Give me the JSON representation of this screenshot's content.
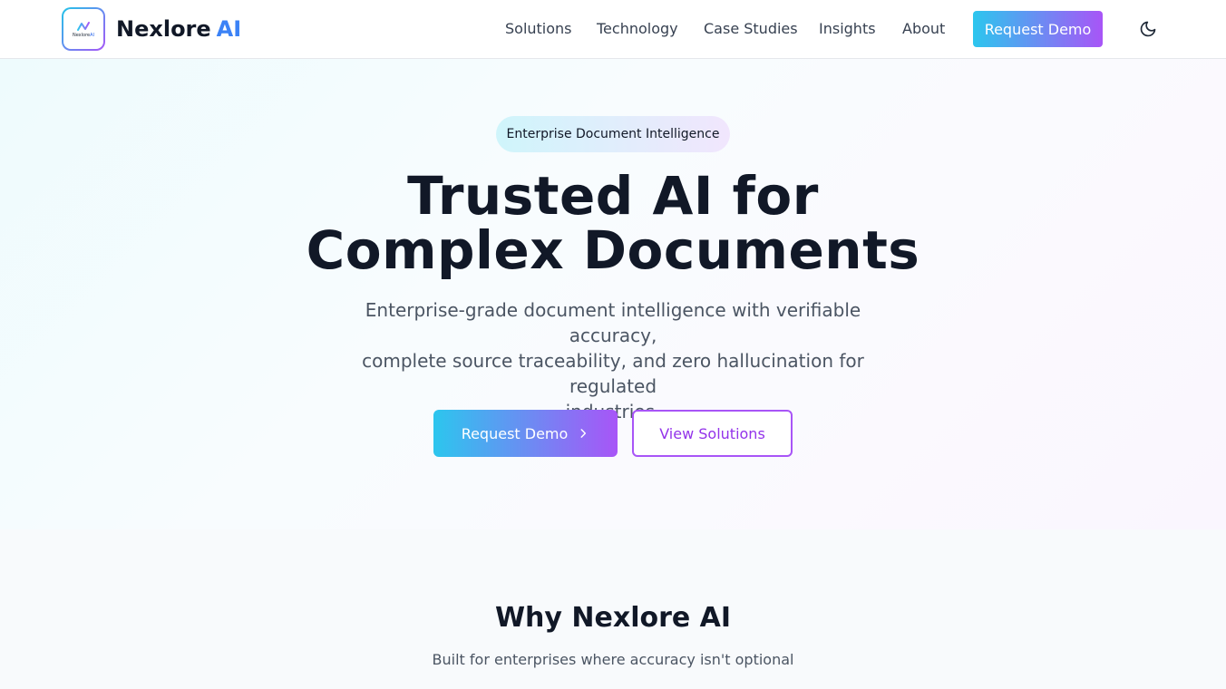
{
  "header": {
    "logo_mini_text": "Nexlore",
    "logo_mini_ai": "AI",
    "brand_name": "Nexlore",
    "brand_accent": "AI",
    "nav": [
      {
        "label": "Solutions"
      },
      {
        "label": "Technology"
      },
      {
        "label": "Case Studies"
      },
      {
        "label": "Insights"
      },
      {
        "label": "About"
      }
    ],
    "cta_label": "Request Demo",
    "theme_icon": "moon-icon"
  },
  "hero": {
    "badge": "Enterprise Document Intelligence",
    "title_lines": [
      "Trusted AI for",
      "Complex Documents"
    ],
    "subtitle_lines": [
      "Enterprise-grade document intelligence with verifiable accuracy,",
      "complete source traceability, and zero hallucination for regulated",
      "industries."
    ],
    "primary_button": "Request Demo",
    "primary_icon": "chevron-right-icon",
    "secondary_button": "View Solutions"
  },
  "why": {
    "title": "Why Nexlore AI",
    "subtitle": "Built for enterprises where accuracy isn't optional"
  },
  "colors": {
    "gradient_start": "#2cc6ee",
    "gradient_end": "#a855f7",
    "brand_accent": "#3b82f6",
    "text_dark": "#111827",
    "text_muted": "#4b5563"
  }
}
